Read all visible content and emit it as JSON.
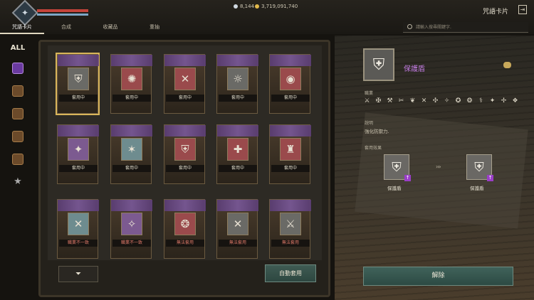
{
  "header": {
    "avatar_glyph": "✦",
    "currency": [
      {
        "icon": "diamond-icon",
        "value": "8,144",
        "color": "#cfd8e0"
      },
      {
        "icon": "gold-coin-icon",
        "value": "3,719,091,740",
        "color": "#e0b84a"
      }
    ],
    "title": "咒語卡片",
    "exit_glyph": "⇥"
  },
  "tabs": [
    {
      "label": "咒語卡片",
      "active": true
    },
    {
      "label": "合成",
      "active": false
    },
    {
      "label": "收藏品",
      "active": false
    },
    {
      "label": "重抽",
      "active": false
    }
  ],
  "search": {
    "placeholder": "請輸入搜尋關鍵字."
  },
  "sidebar": {
    "all_label": "ALL"
  },
  "cards": [
    {
      "emblem": "⛨",
      "color": "gray",
      "label": "套用中",
      "selected": true
    },
    {
      "emblem": "✺",
      "color": "red",
      "label": "套用中"
    },
    {
      "emblem": "✕",
      "color": "red",
      "label": "套用中"
    },
    {
      "emblem": "☼",
      "color": "gray",
      "label": "套用中"
    },
    {
      "emblem": "◉",
      "color": "red",
      "label": "套用中"
    },
    {
      "emblem": "✦",
      "color": "purple",
      "label": "套用中"
    },
    {
      "emblem": "✶",
      "color": "teal",
      "label": "套用中"
    },
    {
      "emblem": "⛨",
      "color": "red",
      "label": "套用中"
    },
    {
      "emblem": "✚",
      "color": "red",
      "label": "套用中"
    },
    {
      "emblem": "♜",
      "color": "red",
      "label": "套用中"
    },
    {
      "emblem": "✕",
      "color": "teal",
      "label": "職業不一致",
      "bad": true
    },
    {
      "emblem": "✧",
      "color": "purple",
      "label": "職業不一致",
      "bad": true
    },
    {
      "emblem": "❂",
      "color": "red",
      "label": "無法套用",
      "bad": true
    },
    {
      "emblem": "✕",
      "color": "gray",
      "label": "無法套用",
      "bad": true
    },
    {
      "emblem": "⚔",
      "color": "gray",
      "label": "無法套用",
      "bad": true
    }
  ],
  "filter_label": "⏷",
  "auto_apply_label": "自動套用",
  "detail": {
    "emblem": "⛨",
    "name": "保護盾",
    "job_label": "職業",
    "jobs": [
      "⚔",
      "✠",
      "⚒",
      "✂",
      "❦",
      "✕",
      "✣",
      "✧",
      "✪",
      "❂",
      "⚕",
      "✦",
      "✢",
      "❖"
    ],
    "desc_label": "說明",
    "desc": "強化防禦力.",
    "effect_label": "套用效果",
    "effect_from_label": "保護盾",
    "effect_to_label": "保護盾",
    "arrow": "›››",
    "release_label": "解除"
  }
}
